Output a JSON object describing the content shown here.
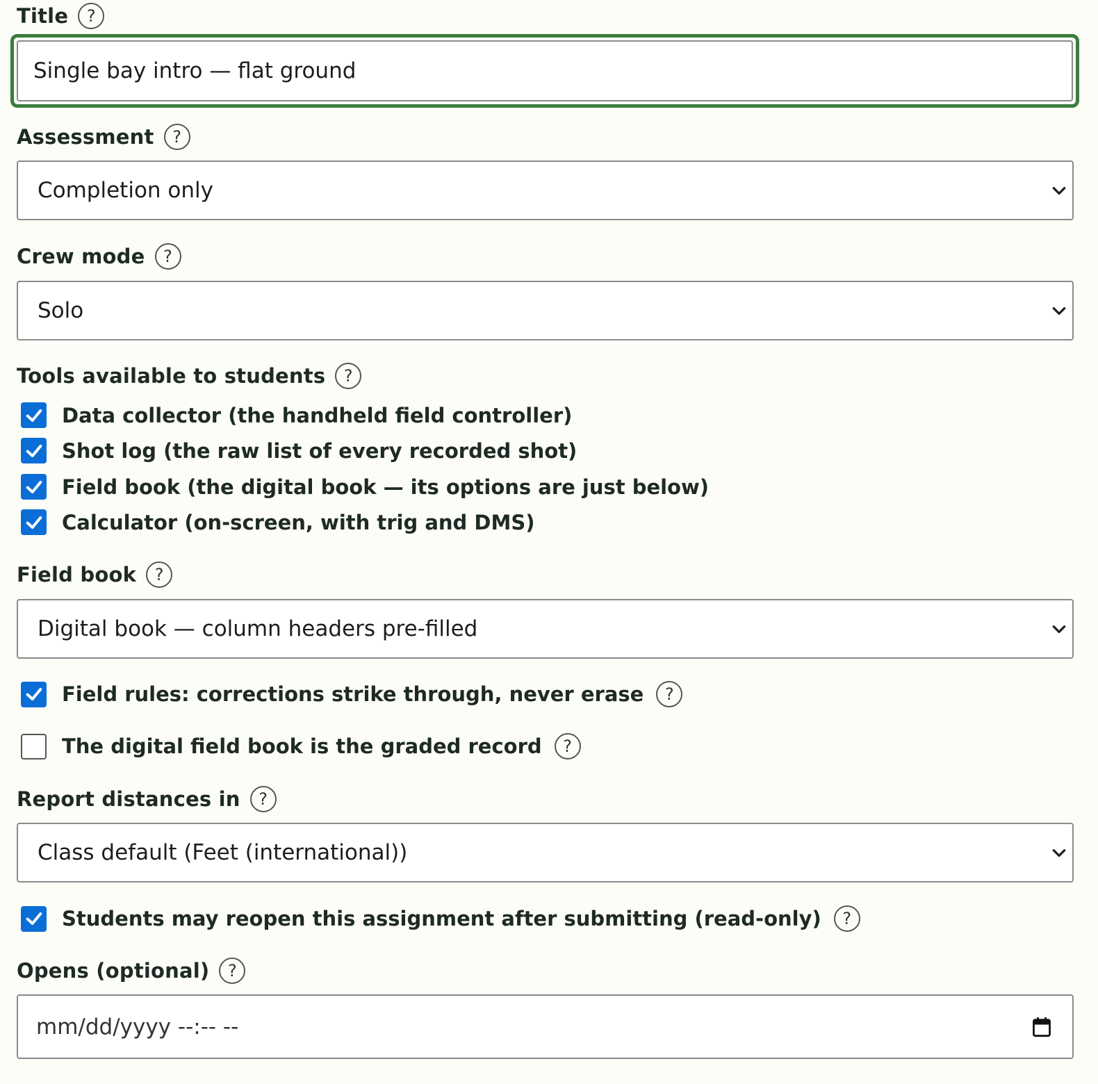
{
  "title": {
    "label": "Title",
    "value": "Single bay intro — flat ground"
  },
  "assessment": {
    "label": "Assessment",
    "value": "Completion only"
  },
  "crew_mode": {
    "label": "Crew mode",
    "value": "Solo"
  },
  "tools": {
    "label": "Tools available to students",
    "items": [
      {
        "label": "Data collector (the handheld field controller)",
        "checked": true
      },
      {
        "label": "Shot log (the raw list of every recorded shot)",
        "checked": true
      },
      {
        "label": "Field book (the digital book — its options are just below)",
        "checked": true
      },
      {
        "label": "Calculator (on-screen, with trig and DMS)",
        "checked": true
      }
    ]
  },
  "field_book": {
    "label": "Field book",
    "value": "Digital book — column headers pre-filled"
  },
  "field_rules": {
    "label": "Field rules: corrections strike through, never erase",
    "checked": true
  },
  "graded_record": {
    "label": "The digital field book is the graded record",
    "checked": false
  },
  "distances": {
    "label": "Report distances in",
    "value": "Class default (Feet (international))"
  },
  "reopen": {
    "label": "Students may reopen this assignment after submitting (read-only)",
    "checked": true
  },
  "opens": {
    "label": "Opens (optional)",
    "placeholder": "mm/dd/yyyy --:-- --"
  },
  "help_glyph": "?",
  "colors": {
    "accent": "#0b6ed6",
    "focus": "#3a7d3f",
    "background": "#fdfdf8"
  }
}
